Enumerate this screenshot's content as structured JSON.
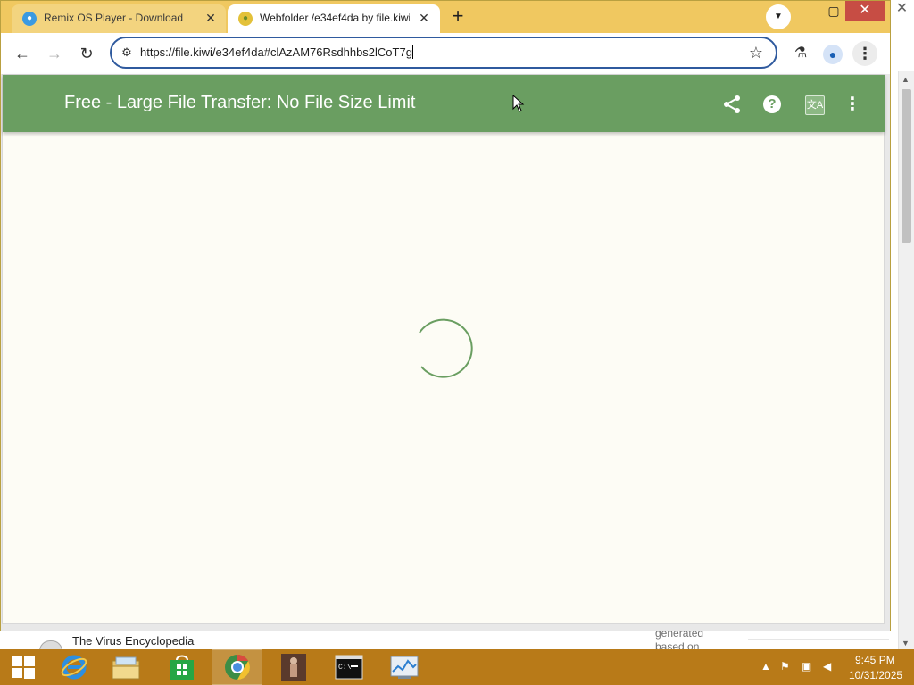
{
  "browser": {
    "tabs": [
      {
        "title": "Remix OS Player - Download",
        "active": false
      },
      {
        "title": "Webfolder /e34ef4da by file.kiwi",
        "active": true
      }
    ],
    "url": "https://file.kiwi/e34ef4da#clAzAM76Rsdhhbs2lCoT7g"
  },
  "page": {
    "title": "Free - Large File Transfer: No File Size Limit",
    "header_icons": [
      "share-icon",
      "help-icon",
      "translate-icon",
      "more-vert-icon"
    ],
    "accent_color": "#6a9e61",
    "loading": true
  },
  "background_page": {
    "link_text": "The Virus Encyclopedia",
    "note": "generated based on"
  },
  "taskbar": {
    "apps": [
      "internet-explorer",
      "file-explorer",
      "store",
      "chrome",
      "photo-viewer",
      "command-prompt",
      "resource-monitor"
    ],
    "time": "9:45 PM",
    "date": "10/31/2025"
  }
}
